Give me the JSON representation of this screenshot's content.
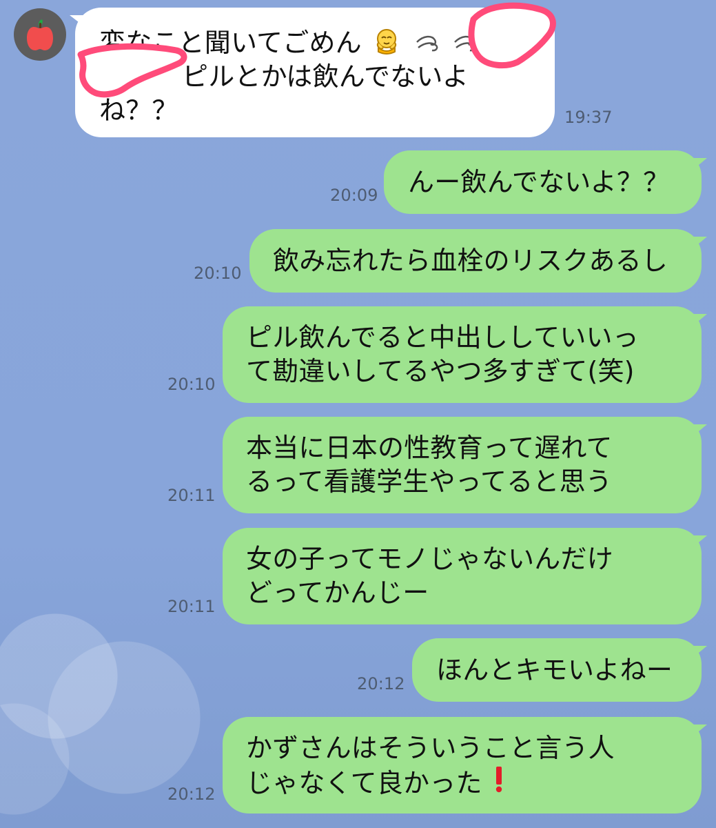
{
  "chat": {
    "contact": {
      "avatar_icon": "apple-icon"
    },
    "messages": [
      {
        "id": "m1",
        "direction": "incoming",
        "time": "19:37",
        "lines": [
          "変なこと聞いてごめん",
          "ピルとかは飲んでないよ",
          "ね？？"
        ],
        "icons": [
          "crying-face-icon",
          "wind-icon",
          "wind-icon"
        ],
        "redactions": [
          "scribble-top-right",
          "scribble-left-middle"
        ]
      },
      {
        "id": "m2",
        "direction": "outgoing",
        "time": "20:09",
        "lines": [
          "んー飲んでないよ？？"
        ]
      },
      {
        "id": "m3",
        "direction": "outgoing",
        "time": "20:10",
        "lines": [
          "飲み忘れたら血栓のリスクあるし"
        ]
      },
      {
        "id": "m4",
        "direction": "outgoing",
        "time": "20:10",
        "lines": [
          "ピル飲んでると中出ししていいっ",
          "て勘違いしてるやつ多すぎて(笑)"
        ]
      },
      {
        "id": "m5",
        "direction": "outgoing",
        "time": "20:11",
        "lines": [
          "本当に日本の性教育って遅れて",
          "るって看護学生やってると思う"
        ]
      },
      {
        "id": "m6",
        "direction": "outgoing",
        "time": "20:11",
        "lines": [
          "女の子ってモノじゃないんだけ",
          "どってかんじー"
        ]
      },
      {
        "id": "m7",
        "direction": "outgoing",
        "time": "20:12",
        "lines": [
          "ほんとキモいよねー"
        ]
      },
      {
        "id": "m8",
        "direction": "outgoing",
        "time": "20:12",
        "lines": [
          "かずさんはそういうこと言う人",
          "じゃなくて良かった"
        ],
        "icons": [
          "exclamation-icon"
        ]
      }
    ]
  },
  "colors": {
    "background": "#8ba8d9",
    "incoming_bubble": "#ffffff",
    "outgoing_bubble": "#9ee38f",
    "redaction": "#ff4b7a"
  }
}
